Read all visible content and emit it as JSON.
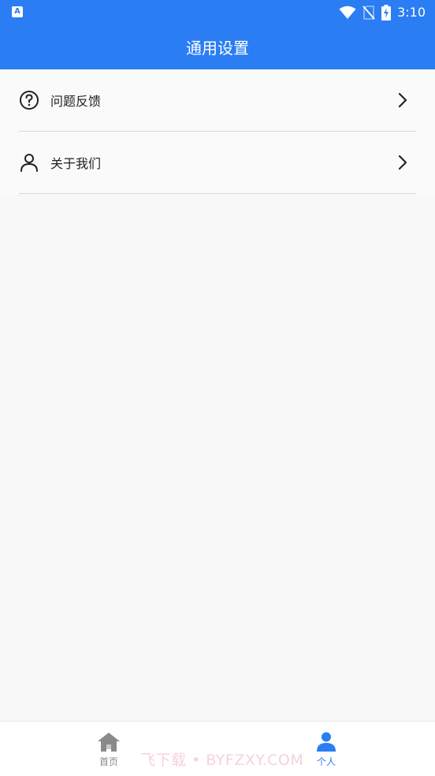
{
  "status_bar": {
    "time": "3:10",
    "left_icon_letter": "A",
    "icons": [
      "wifi-icon",
      "no-sim-icon",
      "battery-charging-icon"
    ]
  },
  "app_bar": {
    "title": "通用设置"
  },
  "settings": {
    "items": [
      {
        "label": "问题反馈",
        "icon": "help-circle-icon"
      },
      {
        "label": "关于我们",
        "icon": "user-icon"
      }
    ]
  },
  "tab_bar": {
    "tabs": [
      {
        "label": "首页",
        "icon": "home-icon",
        "active": false
      },
      {
        "label": "个人",
        "icon": "person-icon",
        "active": true
      }
    ]
  },
  "watermark": "飞下载 • BYFZXY.COM",
  "colors": {
    "primary": "#2a7df3",
    "inactive_tab": "#888888",
    "background": "#f8f8f8",
    "divider": "#dadada"
  }
}
